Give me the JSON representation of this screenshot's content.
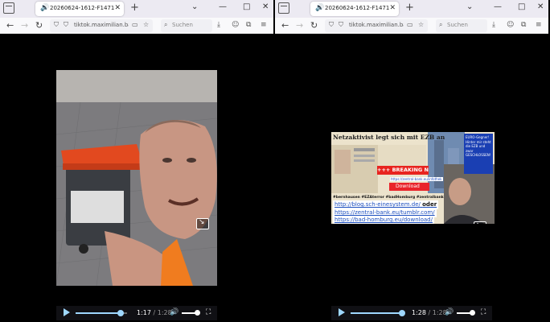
{
  "windows": [
    {
      "tab_title": "20260624-1612-F147121220135",
      "url": "tiktok.maximilian.bau",
      "search_placeholder": "Suchen",
      "time_current": "1:17",
      "time_total": "1:28",
      "progress": 0.875
    },
    {
      "tab_title": "20260624-1612-F147121220135",
      "url": "tiktok.maximilian.bau",
      "search_placeholder": "Suchen",
      "time_current": "1:28",
      "time_total": "1:28",
      "progress": 1.0
    }
  ],
  "icons": {
    "speaker": "🔊",
    "close": "✕",
    "new_tab": "+",
    "back": "←",
    "forward": "→",
    "reload": "↻",
    "shield": "⛉",
    "pip": "▭",
    "star": "☆",
    "search": "⌕",
    "download": "⤓",
    "account": "☺",
    "extensions": "⧉",
    "menu": "≡",
    "chevron": "⌄",
    "minimize": "—",
    "maximize": "□",
    "window_close": "✕",
    "volume": "🔊",
    "fullscreen": "⛶"
  },
  "slide": {
    "headline": "Netzaktivist legt sich mit EZB an",
    "euro_box": "EURO-Gegner! Hinter mir steht die EZB und zwar GESCHLOSSEN!",
    "breaking": "+++ BREAKING NEWS +++",
    "small_url": "https://zentral-bank.eu/infothek",
    "download_label": "Download",
    "hashtags": "#bernhausen #EZAterror #badHomburg #zentralbank",
    "links": [
      "http://blog.sch-einesystem.de/",
      "https://zentral-bank.eu/tumblr.com/",
      "https://bad-homburg.eu/download/"
    ],
    "link_extra": "oder"
  },
  "colors": {
    "accent": "#9fd8ff",
    "breaking_red": "#e8241f",
    "bin_orange": "#e2491f"
  }
}
